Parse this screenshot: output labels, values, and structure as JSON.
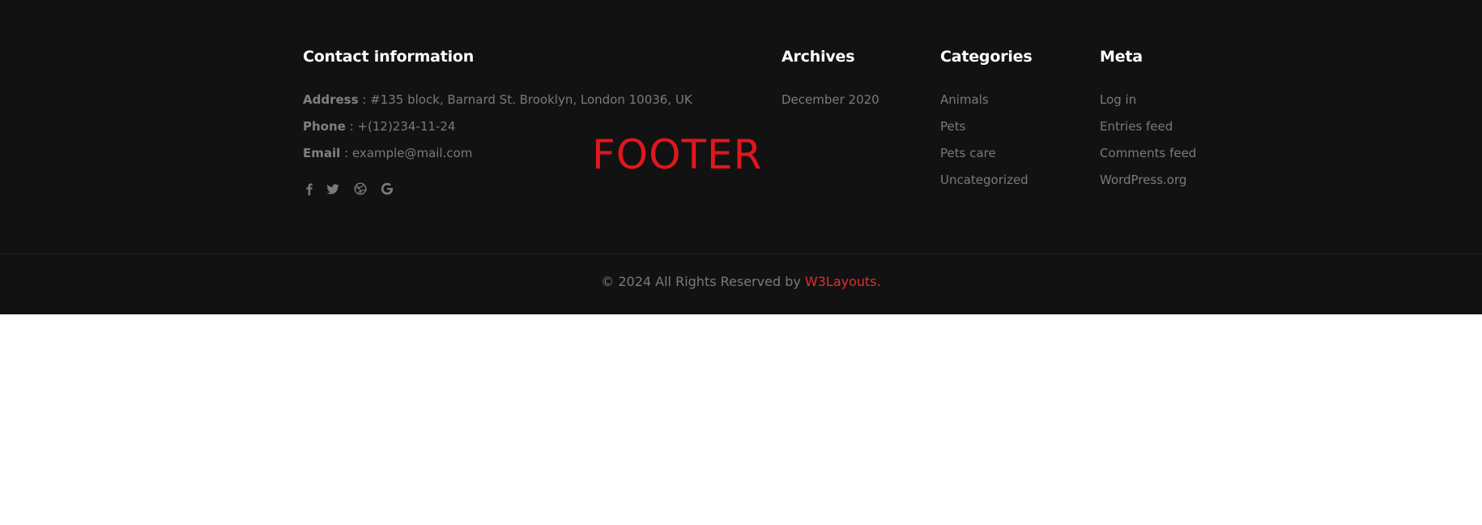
{
  "overlay_label": "FOOTER",
  "contact": {
    "heading": "Contact information",
    "address_label": "Address",
    "address_value": " : #135 block, Barnard St. Brooklyn, London 10036, UK",
    "phone_label": "Phone",
    "phone_value": " : +(12)234-11-24",
    "email_label": "Email",
    "email_value": " : example@mail.com",
    "social_icons": [
      "facebook-icon",
      "twitter-icon",
      "dribbble-icon",
      "google-icon"
    ]
  },
  "archives": {
    "heading": "Archives",
    "items": [
      "December 2020"
    ]
  },
  "categories": {
    "heading": "Categories",
    "items": [
      "Animals",
      "Pets",
      "Pets care",
      "Uncategorized"
    ]
  },
  "meta": {
    "heading": "Meta",
    "items": [
      "Log in",
      "Entries feed",
      "Comments feed",
      "WordPress.org"
    ]
  },
  "copyright": {
    "text": "© 2024 All Rights Reserved by ",
    "link_text": "W3Layouts."
  },
  "colors": {
    "footer_bg": "#121212",
    "heading": "#ffffff",
    "muted_text": "#7a7a7a",
    "accent": "#e0302c",
    "overlay": "#e0171d"
  }
}
